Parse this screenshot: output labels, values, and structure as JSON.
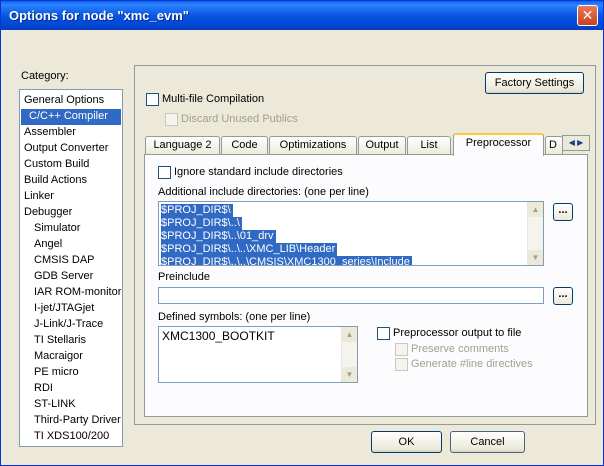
{
  "window": {
    "title": "Options for node \"xmc_evm\"",
    "close_glyph": "✕"
  },
  "category": {
    "label": "Category:",
    "items": [
      "General Options",
      "C/C++ Compiler",
      "Assembler",
      "Output Converter",
      "Custom Build",
      "Build Actions",
      "Linker",
      "Debugger",
      "Simulator",
      "Angel",
      "CMSIS DAP",
      "GDB Server",
      "IAR ROM-monitor",
      "I-jet/JTAGjet",
      "J-Link/J-Trace",
      "TI Stellaris",
      "Macraigor",
      "PE micro",
      "RDI",
      "ST-LINK",
      "Third-Party Driver",
      "TI XDS100/200"
    ],
    "selected": "C/C++ Compiler"
  },
  "top": {
    "factory_settings": "Factory Settings",
    "multifile_label": "Multi-file Compilation",
    "discard_label": "Discard Unused Publics"
  },
  "tabs": [
    "Language 2",
    "Code",
    "Optimizations",
    "Output",
    "List",
    "Preprocessor",
    "D"
  ],
  "active_tab": "Preprocessor",
  "preprocessor": {
    "ignore_label": "Ignore standard include directories",
    "include_label": "Additional include directories: (one per line)",
    "include_lines": [
      "$PROJ_DIR$\\",
      "$PROJ_DIR$\\..\\",
      "$PROJ_DIR$\\..\\01_drv",
      "$PROJ_DIR$\\..\\..\\XMC_LIB\\Header",
      "$PROJ_DIR$\\..\\..\\CMSIS\\XMC1300_series\\Include"
    ],
    "preinclude_label": "Preinclude",
    "preinclude_value": "",
    "defined_label": "Defined symbols: (one per line)",
    "defined_value": "XMC1300_BOOTKIT",
    "ppoutput_label": "Preprocessor output to file",
    "preserve_label": "Preserve comments",
    "generate_label": "Generate #line directives",
    "browse_glyph": "..."
  },
  "buttons": {
    "ok": "OK",
    "cancel": "Cancel"
  }
}
